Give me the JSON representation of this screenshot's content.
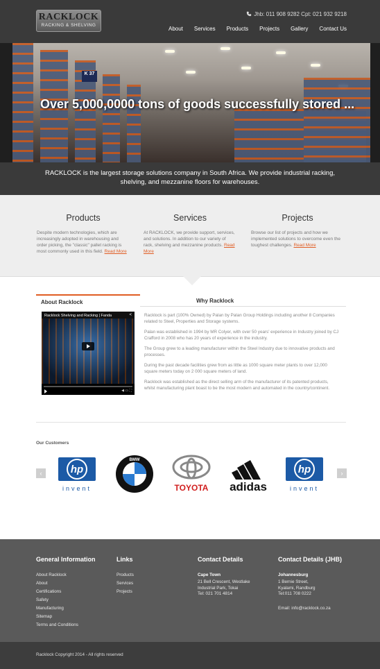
{
  "header": {
    "logo_text": "RACKLOCK",
    "logo_subtext": "RACKING & SHELVING",
    "contact": "Jhb: 011 908 9282   Cpt: 021 932 9218",
    "nav": [
      "About",
      "Services",
      "Products",
      "Projects",
      "Gallery",
      "Contact Us"
    ]
  },
  "hero": {
    "caption": "Over 5,000,0000 tons of goods successfully stored ...",
    "sign_text": "K 37"
  },
  "tagline": "RACKLOCK is the largest storage solutions company in South Africa. We provide industrial racking, shelving, and mezzanine floors for warehouses.",
  "features": [
    {
      "title": "Products",
      "text": "Despite modern technologies, which are increasingly adopted in warehousing and order picking, the \"classic\" pallet racking is most commonly used in this field.",
      "link": "Read More"
    },
    {
      "title": "Services",
      "text": "At RACKLOCK, we provide support, services, and solutions. In addition to our variety of rack, shelving and mezzanine products.",
      "link": "Read More"
    },
    {
      "title": "Projects",
      "text": "Browse our list of projects and how we implemented solutions to overcome even the toughest challenges.",
      "link": "Read More"
    }
  ],
  "tabs": {
    "about": "About Racklock",
    "why": "Why Racklock"
  },
  "video": {
    "title": "Racklock Shelving and Racking | Fanda"
  },
  "about_paragraphs": [
    "Racklock is part (100% Owned) by Palan by Palan Group Holdings including another 8 Companies related to Steel, Properties and Storage systems.",
    "Palan was established in 1994 by MR Colyer, with over 50 years' experience in Industry joined by CJ Crafford in 2008 who has 20 years of experience in the industry.",
    "The Group grew to a leading manufacturer within the Steel Industry due to innovative products and processes.",
    "During the past decade facilities grew from as little as 1000 square meter plants to over 12,000 square meters today on 2 000 square meters of land.",
    "Racklock was established as the direct selling arm of the manufacturer of its patented products, whilst manufacturing plant boast to be the most modern and automated in the country/continent."
  ],
  "customers": {
    "title": "Our Customers",
    "logos": [
      {
        "name": "hp",
        "tagline": "invent",
        "icon": "hp-logo"
      },
      {
        "name": "BMW",
        "icon": "bmw-logo"
      },
      {
        "name": "TOYOTA",
        "icon": "toyota-logo"
      },
      {
        "name": "adidas",
        "icon": "adidas-logo"
      },
      {
        "name": "hp",
        "tagline": "invent",
        "icon": "hp-logo"
      }
    ]
  },
  "footer": {
    "general": {
      "title": "General Information",
      "links": [
        "About Racklock",
        "About",
        "Certifications",
        "Safety",
        "Manufacturing",
        "Sitemap",
        "Terms and Conditions"
      ]
    },
    "links": {
      "title": "Links",
      "links": [
        "Products",
        "Services",
        "Projects"
      ]
    },
    "contact": {
      "title": "Contact Details",
      "region": "Cape Town",
      "address": [
        "21 Bell Crescent, Westlake",
        "Industrial Park, Tokai",
        "Tel: 021 701 4814"
      ]
    },
    "contact_jhb": {
      "title": "Contact Details (JHB)",
      "region": "Johannesburg",
      "address": [
        "1 Bernie Street,",
        "Kyalami, Randburg",
        "Tel:011 708 0222"
      ],
      "email": "Email: info@racklock.co.za"
    },
    "copyright": "Racklock Copyright 2014 - All rights reserved"
  },
  "colors": {
    "accent": "#e05c22",
    "dark": "#3a3a3a",
    "footer": "#5a5a5a"
  }
}
